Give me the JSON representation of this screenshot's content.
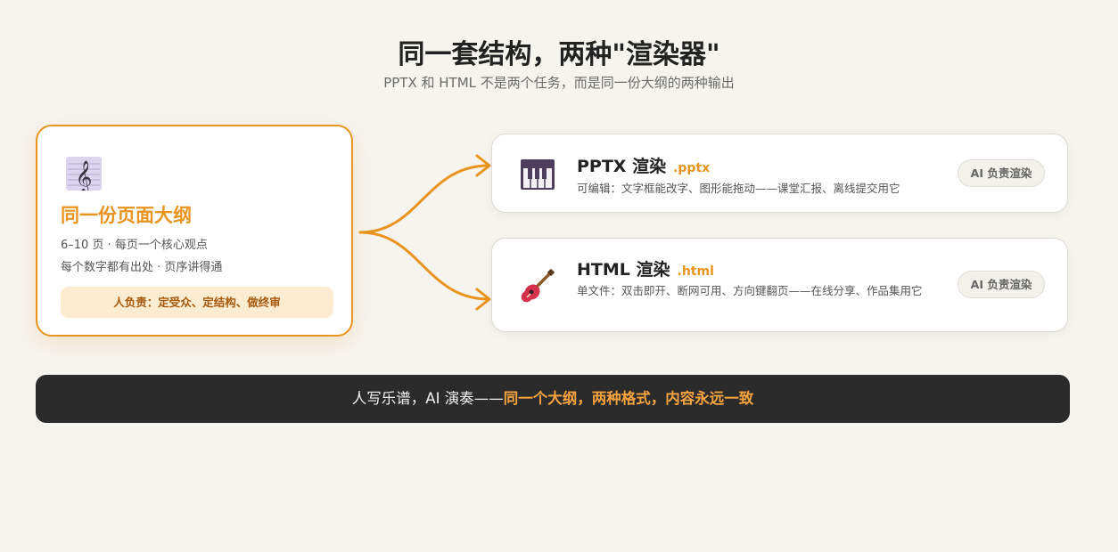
{
  "header": {
    "title": "同一套结构，两种\"渲染器\"",
    "subtitle": "PPTX 和 HTML 不是两个任务，而是同一份大纲的两种输出"
  },
  "source": {
    "icon": "treble-clef-icon",
    "title": "同一份页面大纲",
    "line1": "6–10 页 · 每页一个核心观点",
    "line2": "每个数字都有出处 · 页序讲得通",
    "badge": "人负责：定受众、定结构、做终审"
  },
  "outputs": [
    {
      "icon": "piano-keys-icon",
      "name": "PPTX 渲染",
      "ext": ".pptx",
      "desc": "可编辑：文字框能改字、图形能拖动——课堂汇报、离线提交用它",
      "pill": "AI 负责渲染"
    },
    {
      "icon": "guitar-icon",
      "name": "HTML 渲染",
      "ext": ".html",
      "desc": "单文件：双击即开、断网可用、方向键翻页——在线分享、作品集用它",
      "pill": "AI 负责渲染"
    }
  ],
  "footer": {
    "lead": "人写乐谱，AI 演奏——",
    "highlight": "同一个大纲，两种格式，内容永远一致"
  },
  "colors": {
    "accent": "#e8941f",
    "background": "#f6f4ef",
    "bar": "#2b2b2b",
    "highlight": "#f5a340"
  }
}
